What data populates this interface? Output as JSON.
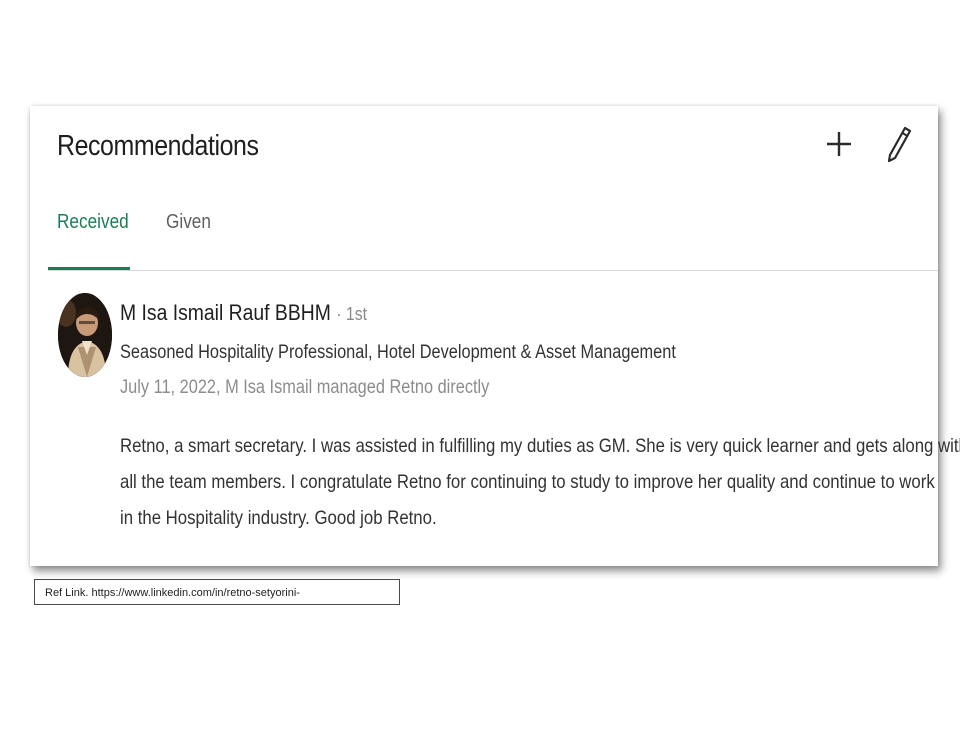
{
  "section": {
    "title": "Recommendations",
    "add_icon": "plus-icon",
    "edit_icon": "pencil-icon"
  },
  "tabs": [
    {
      "label": "Received",
      "active": true
    },
    {
      "label": "Given",
      "active": false
    }
  ],
  "colors": {
    "accent": "#1a7f55",
    "divider": "#d9d9d9",
    "muted_text": "#8c8c8c"
  },
  "recommendation": {
    "name": "M Isa Ismail Rauf BBHM",
    "degree": "· 1st",
    "headline": "Seasoned Hospitality Professional, Hotel Development & Asset Management",
    "meta": "July 11, 2022, M Isa Ismail managed Retno directly",
    "body_lines": [
      "Retno, a smart secretary. I was assisted in fulfilling my duties as GM. She is very quick learner and gets along with",
      "all the team members. I congratulate Retno for continuing to study to improve her quality and continue to work",
      "in the Hospitality industry. Good job Retno."
    ]
  },
  "reference": {
    "text": "Ref Link. https://www.linkedin.com/in/retno-setyorini-"
  }
}
